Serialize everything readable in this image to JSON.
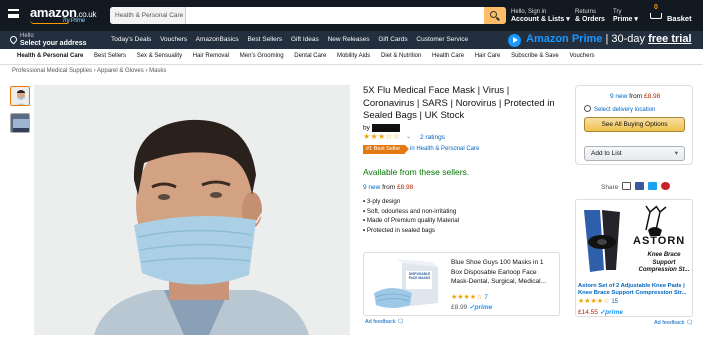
{
  "header": {
    "logo": "amazon",
    "logo_tld": ".co.uk",
    "logo_prime": "Try Prime",
    "search_category": "Health & Personal Care",
    "account_small": "Hello, Sign in",
    "account_big": "Account & Lists",
    "returns_small": "Returns",
    "returns_big": "& Orders",
    "prime_small": "Try",
    "prime_big": "Prime",
    "cart_count": "0",
    "cart_label": "Basket"
  },
  "subnav": {
    "address_small": "Hello",
    "address_big": "Select your address",
    "links": [
      "Today's Deals",
      "Vouchers",
      "AmazonBasics",
      "Best Sellers",
      "Gift Ideas",
      "New Releases",
      "Gift Cards",
      "Customer Service"
    ],
    "prime_banner": "Amazon Prime",
    "prime_banner_rest": "| 30-day",
    "prime_banner_trial": "free trial"
  },
  "category_nav": [
    "Health & Personal Care",
    "Best Sellers",
    "Sex & Sensuality",
    "Hair Removal",
    "Men's Grooming",
    "Dental Care",
    "Mobility Aids",
    "Diet & Nutrition",
    "Health Care",
    "Hair Care",
    "Subscribe & Save",
    "Vouchers"
  ],
  "breadcrumb": "Professional Medical Supplies › Apparel & Gloves › Masks",
  "product": {
    "title": "5X Flu Medical Face Mask | Virus | Coronavirus | SARS | Norovirus | Protected in Sealed Bags | UK Stock",
    "by": "by",
    "stars": "★★★☆☆",
    "ratings": "2 ratings",
    "badge": "#1 Best Seller",
    "badge_category": "in Health & Personal Care",
    "availability": "Available from these sellers.",
    "new_count": "9 new",
    "new_from": "from",
    "price": "£8.98",
    "bullets": [
      "3-ply design",
      "Soft, odourless and non-irritating",
      "Made of Premium quality Material",
      "Protected in sealed bags"
    ]
  },
  "sponsored": {
    "description": "Blue Shoe Guys 100 Masks in 1 Box Disposable Earloop Face Mask-Dental, Surgical, Medical...",
    "stars": "★★★★☆",
    "rating_count": "7",
    "price": "£8.99",
    "prime": "✓prime",
    "box_text": "DISPOSABLE FACE MASKS"
  },
  "ad_feedback": "Ad feedback",
  "buybox": {
    "new_count": "9 new",
    "new_from": "from",
    "price": "£8.98",
    "delivery": "Select delivery location",
    "all_options": "See All Buying Options",
    "add_to_list": "Add to List"
  },
  "share_label": "Share",
  "ad": {
    "brand": "ASTORN",
    "tagline": "Knee Brace Support Compression St...",
    "link": "Astorn Set of 2 Adjustable Knee Pads | Knee Brace Support Compression Str...",
    "stars": "★★★★☆",
    "rating_count": "15",
    "price": "£14.55",
    "prime": "✓prime"
  }
}
